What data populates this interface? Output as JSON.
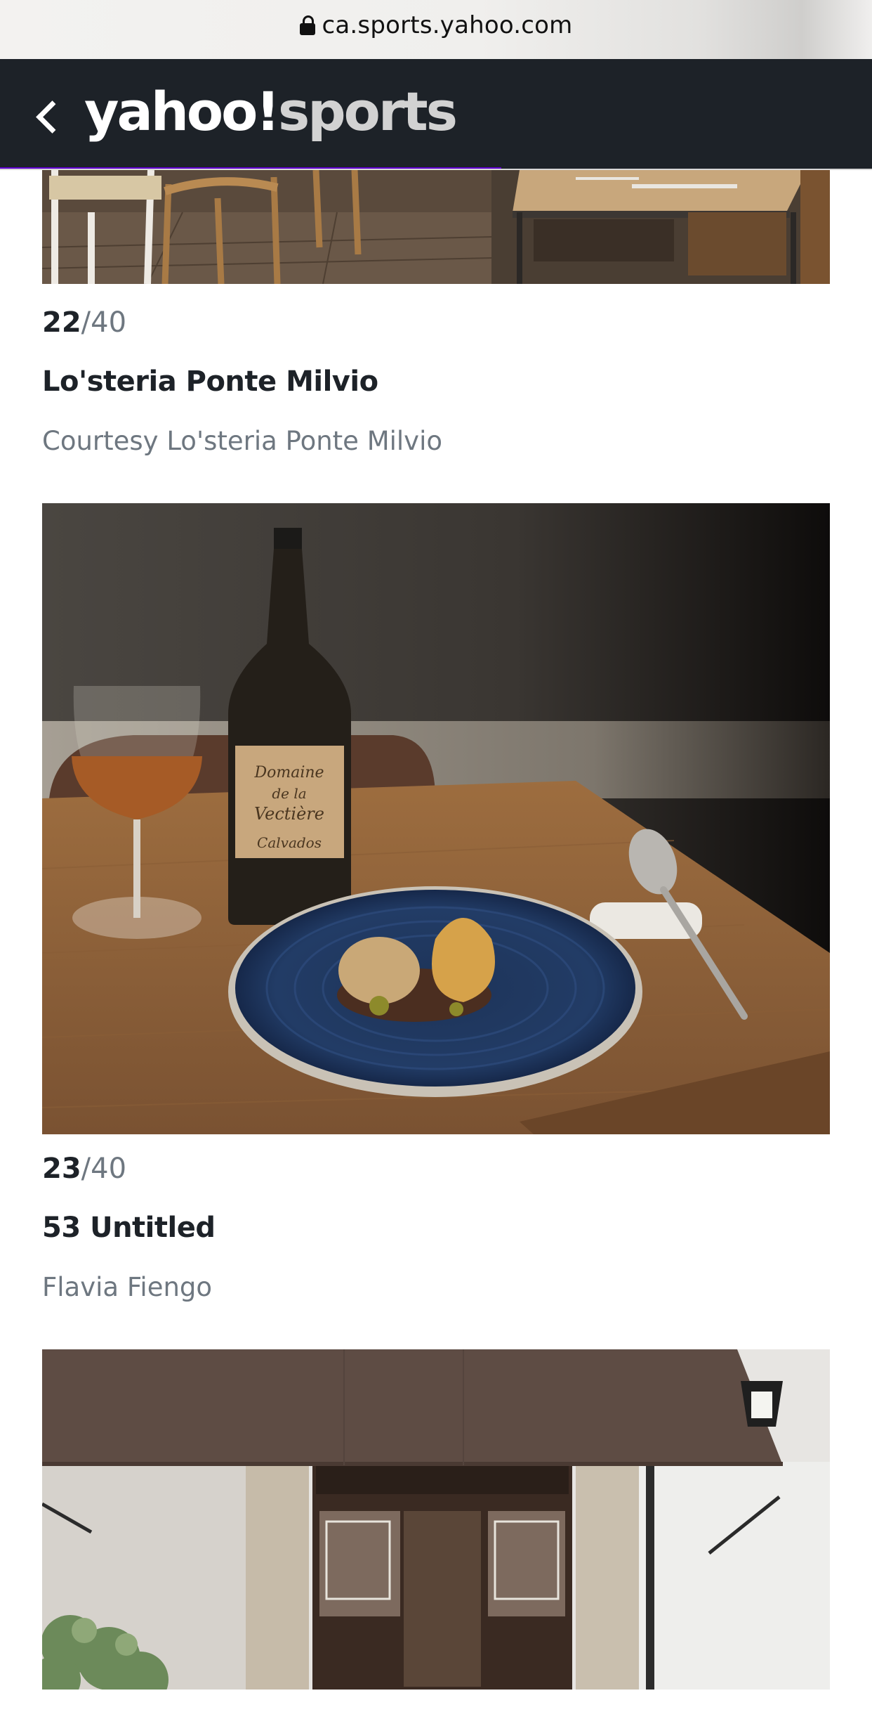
{
  "browser": {
    "url": "ca.sports.yahoo.com",
    "lock_icon": "lock-icon"
  },
  "header": {
    "back_icon": "chevron-left-icon",
    "brand_yahoo": "yahoo!",
    "brand_sports": "sports",
    "progress_fraction": 0.575,
    "background_color": "#1d2228",
    "progress_color": "#6001d2"
  },
  "slides": [
    {
      "image": "restaurant-interior-chairs-tables",
      "current": "22",
      "total": "/40",
      "title": "Lo'steria Ponte Milvio",
      "credit": "Courtesy Lo'steria Ponte Milvio"
    },
    {
      "image": "wine-bottle-glass-dessert-plate",
      "current": "23",
      "total": "/40",
      "title": "53 Untitled",
      "credit": "Flavia Fiengo"
    },
    {
      "image": "restaurant-storefront-awning"
    }
  ]
}
